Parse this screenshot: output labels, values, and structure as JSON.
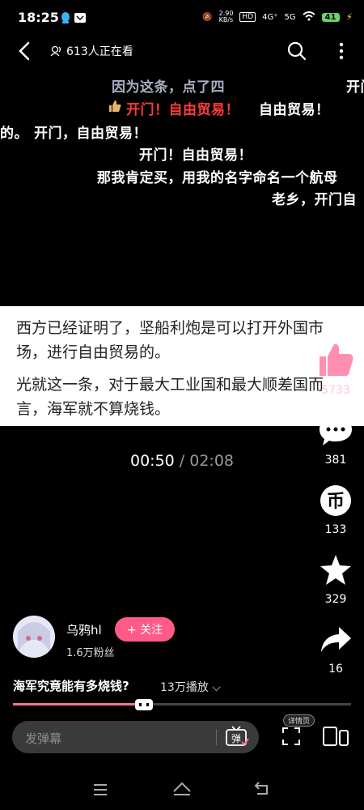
{
  "status_bar": {
    "time": "18:25",
    "speed": "2.90\nKB/s",
    "net1": "HD",
    "net2": "4G⁺",
    "net3": "5G",
    "battery": "41"
  },
  "top_nav": {
    "viewers": "613人正在看"
  },
  "danmaku": [
    {
      "text": "因为这条，点了四",
      "style": "faded"
    },
    {
      "text": "开门！自由贸易！",
      "style": "hl"
    },
    {
      "text": "自由贸易！",
      "style": "normal"
    },
    {
      "text": "开门，自由贸易！",
      "style": "normal"
    },
    {
      "text": "的。",
      "style": "normal"
    },
    {
      "text": "开门！自由贸易！",
      "style": "normal"
    },
    {
      "text": "那我肯定买，用我的名字命名一个航母",
      "style": "normal"
    },
    {
      "text": "老乡，开门自",
      "style": "normal"
    },
    {
      "text": "开门",
      "style": "normal"
    }
  ],
  "card": {
    "line1": "西方已经证明了，坚船利炮是可以打开外国市场，进行自由贸易的。",
    "line2": "光就这一条，对于最大工业国和最大顺差国而言，海军就不算烧钱。"
  },
  "rail": {
    "like_count": "5733",
    "comment_count": "381",
    "coin_count": "133",
    "fav_count": "329",
    "share_count": "16"
  },
  "timer": {
    "current": "00:50",
    "total": " / 02:08"
  },
  "author": {
    "name": "乌鸦hl",
    "follow_label": "+ 关注",
    "fans": "1.6万粉丝"
  },
  "video": {
    "title": "海军究竟能有多烧钱?",
    "plays": "13万播放"
  },
  "progress": {
    "fraction": 0.4
  },
  "input_bar": {
    "placeholder": "发弹幕",
    "detail_tag": "详情页",
    "danmaku_icon_label": "弹"
  }
}
